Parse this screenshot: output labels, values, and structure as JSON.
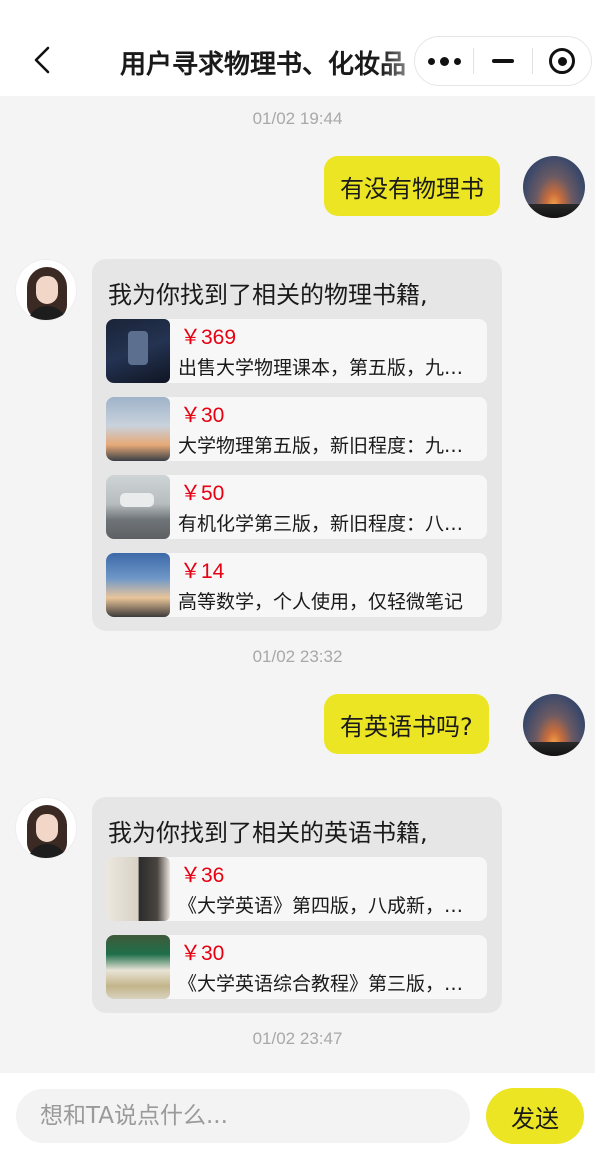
{
  "header": {
    "title": "用户寻求物理书、化妆品",
    "back_icon": "chevron-left-icon",
    "capsule": [
      "more-dots-icon",
      "minimize-icon",
      "target-icon"
    ]
  },
  "messages": [
    {
      "time": "01/02 19:44"
    },
    {
      "from": "user",
      "text": "有没有物理书",
      "avatar": "user-avatar"
    },
    {
      "from": "bot",
      "text": "我为你找到了相关的物理书籍,",
      "avatar": "bot-avatar",
      "products": [
        {
          "price": "￥369",
          "desc": "出售大学物理课本，第五版，九成新"
        },
        {
          "price": "￥30",
          "desc": "大学物理第五版，新旧程度：九成新"
        },
        {
          "price": "￥50",
          "desc": "有机化学第三版，新旧程度：八成新"
        },
        {
          "price": "￥14",
          "desc": "高等数学，个人使用，仅轻微笔记"
        }
      ]
    },
    {
      "time": "01/02 23:32"
    },
    {
      "from": "user",
      "text": "有英语书吗?",
      "avatar": "user-avatar"
    },
    {
      "from": "bot",
      "text": "我为你找到了相关的英语书籍,",
      "avatar": "bot-avatar",
      "products": [
        {
          "price": "￥36",
          "desc": "《大学英语》第四版，八成新，无笔记"
        },
        {
          "price": "￥30",
          "desc": "《大学英语综合教程》第三版，九成新"
        }
      ]
    },
    {
      "time": "01/02 23:47"
    }
  ],
  "input": {
    "placeholder": "想和TA说点什么...",
    "value": "",
    "send_label": "发送"
  },
  "colors": {
    "accent": "#ece523",
    "price": "#e60012",
    "background": "#f4f4f4",
    "bot_bubble": "#e6e6e6"
  }
}
